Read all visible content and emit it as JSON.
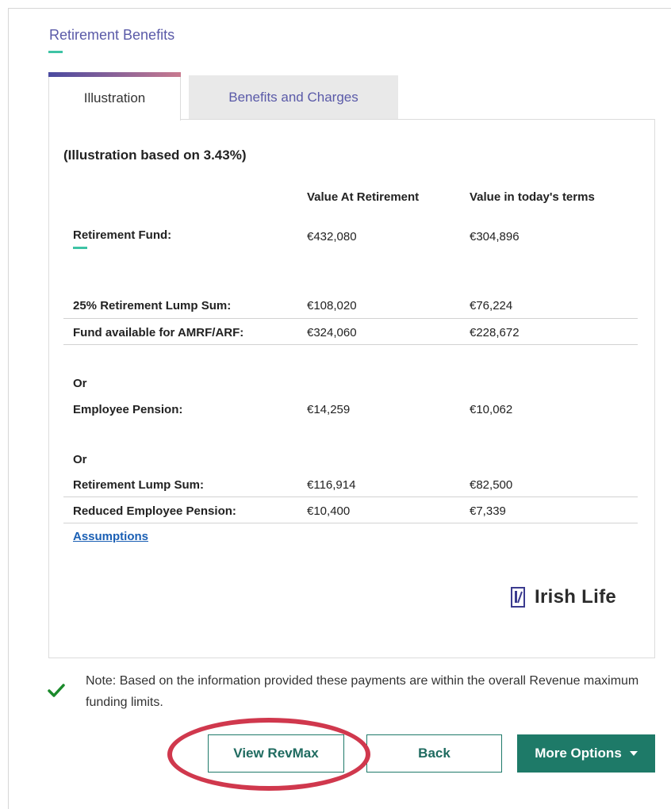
{
  "section": {
    "title": "Retirement Benefits"
  },
  "tabs": [
    {
      "label": "Illustration",
      "active": true
    },
    {
      "label": "Benefits and Charges",
      "active": false
    }
  ],
  "illustration": {
    "caption": "(Illustration based on 3.43%)",
    "columns": [
      "Value At Retirement",
      "Value in today's terms"
    ],
    "rows": [
      {
        "label": "Retirement Fund:",
        "v1": "€432,080",
        "v2": "€304,896"
      },
      {
        "label": "25% Retirement Lump Sum:",
        "v1": "€108,020",
        "v2": "€76,224"
      },
      {
        "label": "Fund available for AMRF/ARF:",
        "v1": "€324,060",
        "v2": "€228,672"
      },
      {
        "label": "Or"
      },
      {
        "label": "Employee Pension:",
        "v1": "€14,259",
        "v2": "€10,062"
      },
      {
        "label": "Or"
      },
      {
        "label": "Retirement Lump Sum:",
        "v1": "€116,914",
        "v2": "€82,500"
      },
      {
        "label": "Reduced Employee Pension:",
        "v1": "€10,400",
        "v2": "€7,339"
      }
    ],
    "assumptions_link": "Assumptions",
    "logo_text": "Irish Life"
  },
  "note": {
    "text": "Note: Based on the information provided these payments are within the overall Revenue maximum funding limits.",
    "icon": "checkmark-icon"
  },
  "buttons": {
    "view_revmax": "View RevMax",
    "back": "Back",
    "more_options": "More Options"
  },
  "colors": {
    "accent_teal": "#3ec3a5",
    "title_purple": "#5a5aa8",
    "button_green": "#1e7a68",
    "highlight_red": "#d0384d",
    "check_green": "#1b8a2b"
  }
}
